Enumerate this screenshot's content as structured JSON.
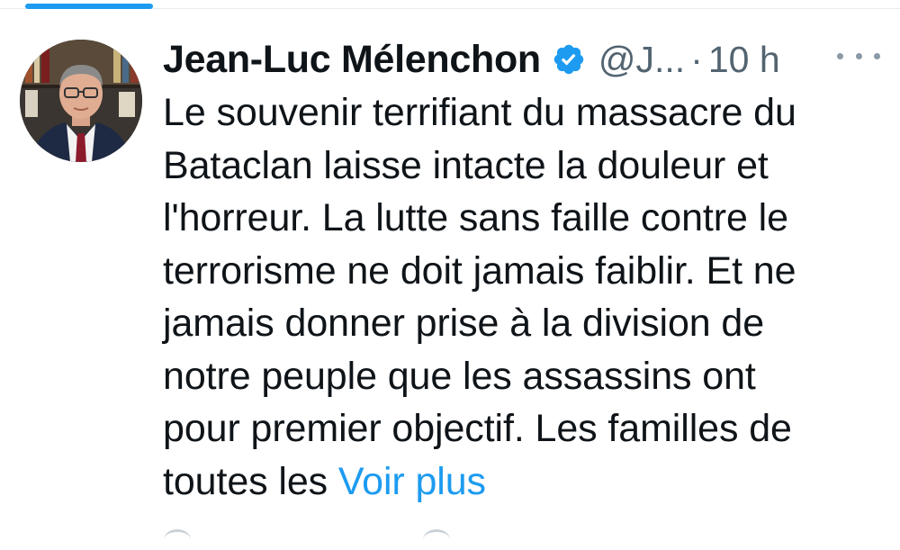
{
  "colors": {
    "accent": "#1d9bf0",
    "text": "#0f1419",
    "secondary": "#536471"
  },
  "tweet": {
    "author": {
      "display_name": "Jean-Luc Mélenchon",
      "verified": true,
      "verified_icon": "verified-badge-icon",
      "handle": "@J...",
      "avatar_icon": "profile-photo"
    },
    "separator": "·",
    "timestamp": "10 h",
    "more_icon": "more-options-icon",
    "text_lines": [
      "Le souvenir terrifiant du massacre du",
      "Bataclan laisse intacte la douleur et",
      "l'horreur. La lutte sans faille contre le",
      "terrorisme ne doit jamais faiblir. Et ne",
      "jamais donner prise à la division de",
      "notre peuple que les assassins ont",
      "pour premier objectif. Les familles de",
      "toutes les"
    ],
    "show_more_label": "Voir plus"
  }
}
